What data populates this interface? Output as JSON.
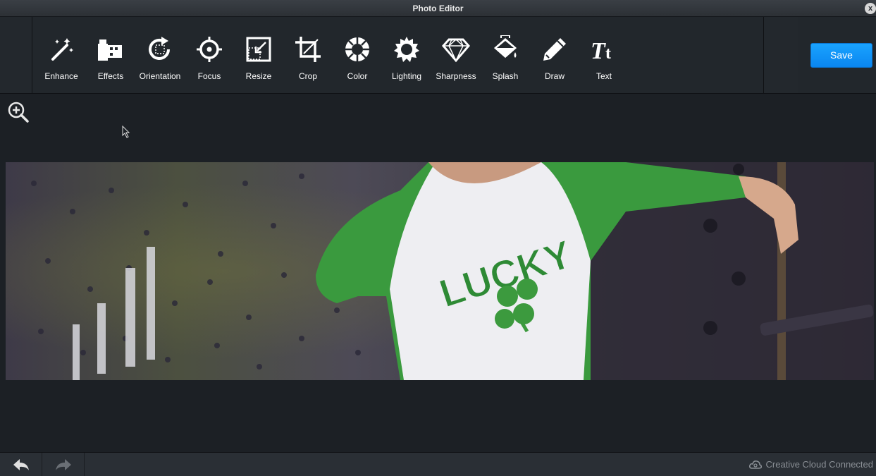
{
  "window": {
    "title": "Photo Editor",
    "close_label": "x"
  },
  "tools": [
    {
      "label": "Enhance",
      "icon": "magic-wand-icon"
    },
    {
      "label": "Effects",
      "icon": "film-icon"
    },
    {
      "label": "Orientation",
      "icon": "rotate-icon"
    },
    {
      "label": "Focus",
      "icon": "focus-target-icon"
    },
    {
      "label": "Resize",
      "icon": "resize-icon"
    },
    {
      "label": "Crop",
      "icon": "crop-icon"
    },
    {
      "label": "Color",
      "icon": "color-wheel-icon"
    },
    {
      "label": "Lighting",
      "icon": "sun-icon"
    },
    {
      "label": "Sharpness",
      "icon": "diamond-icon"
    },
    {
      "label": "Splash",
      "icon": "paint-bucket-icon"
    },
    {
      "label": "Draw",
      "icon": "pencil-icon"
    },
    {
      "label": "Text",
      "icon": "text-icon"
    }
  ],
  "save_label": "Save",
  "photo": {
    "shirt_text": "LUCKY"
  },
  "status": {
    "text": "Creative Cloud Connected"
  },
  "colors": {
    "accent": "#1197f8",
    "background": "#1c2025",
    "toolbar": "#22272c"
  }
}
